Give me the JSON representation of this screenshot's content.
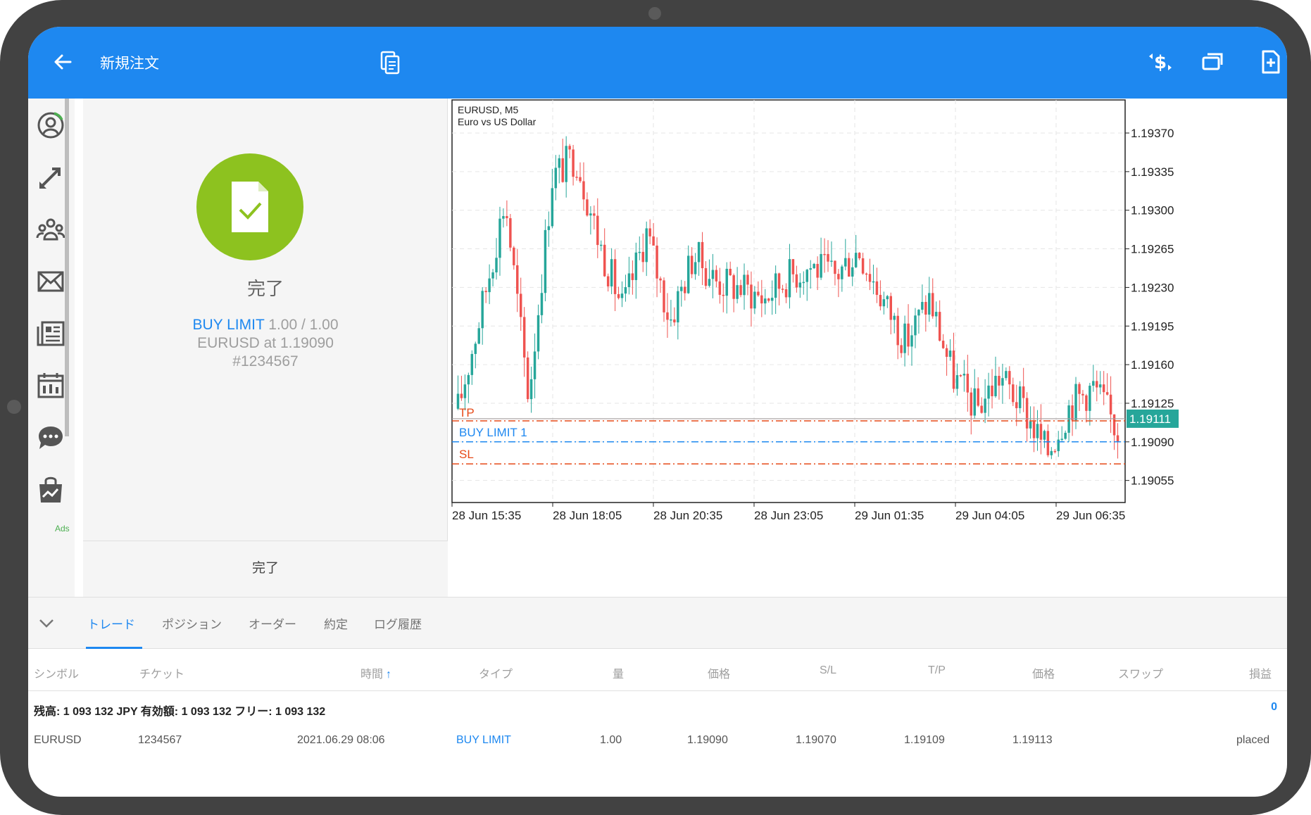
{
  "appbar": {
    "title": "新規注文",
    "icons": [
      "back-arrow-icon",
      "document-icon",
      "currency-exchange-icon",
      "window-icon",
      "new-document-icon"
    ]
  },
  "sidebar": {
    "icons": [
      "account-icon",
      "trade-icon",
      "community-icon",
      "mail-icon",
      "news-icon",
      "calendar-icon",
      "chat-icon",
      "market-bag-icon"
    ],
    "ads_label": "Ads"
  },
  "order_panel": {
    "status_title": "完了",
    "type": "BUY LIMIT",
    "volume": "1.00 / 1.00",
    "symbol_price": "EURUSD at 1.19090",
    "ticket": "#1234567",
    "done_button": "完了"
  },
  "chart": {
    "symbol": "EURUSD, M5",
    "description": "Euro vs US Dollar",
    "price_ticks": [
      "1.19370",
      "1.19335",
      "1.19300",
      "1.19265",
      "1.19230",
      "1.19195",
      "1.19160",
      "1.19125",
      "1.19090",
      "1.19055"
    ],
    "time_ticks": [
      "28 Jun 15:35",
      "28 Jun 18:05",
      "28 Jun 20:35",
      "28 Jun 23:05",
      "29 Jun 01:35",
      "29 Jun 04:05",
      "29 Jun 06:35"
    ],
    "current_price": "1.19111",
    "tp_label": "TP",
    "order_label": "BUY LIMIT 1",
    "sl_label": "SL",
    "tp_price": 1.19109,
    "order_price": 1.1909,
    "sl_price": 1.1907,
    "colors": {
      "bull": "#26a69a",
      "bear": "#ef5350",
      "order": "#1e88f0",
      "stop": "#e64a19"
    }
  },
  "chart_data": {
    "type": "candlestick",
    "title": "EURUSD, M5",
    "subtitle": "Euro vs US Dollar",
    "categories": [
      "28 Jun 15:35",
      "28 Jun 18:05",
      "28 Jun 20:35",
      "28 Jun 23:05",
      "29 Jun 01:35",
      "29 Jun 04:05",
      "29 Jun 06:35"
    ],
    "ylim": [
      1.19035,
      1.194
    ],
    "series": [
      {
        "values": [
          1.1912,
          1.1921,
          1.1931,
          1.1913,
          1.1933,
          1.1935,
          1.1927,
          1.1921,
          1.1928,
          1.192,
          1.1926,
          1.19235,
          1.1923,
          1.1922,
          1.1924,
          1.1925,
          1.1924,
          1.19265,
          1.1922,
          1.1918,
          1.1922,
          1.1915,
          1.1912,
          1.1915,
          1.1912,
          1.1908,
          1.19125,
          1.1914,
          1.191
        ]
      }
    ]
  },
  "tabs": [
    "トレード",
    "ポジション",
    "オーダー",
    "約定",
    "ログ履歴"
  ],
  "table": {
    "headers": [
      "シンボル",
      "チケット",
      "時間",
      "タイプ",
      "量",
      "価格",
      "S/L",
      "T/P",
      "価格",
      "スワップ",
      "損益"
    ],
    "sort_indicator": "↑",
    "balance_line": "残高:  1 093 132 JPY   有効額:  1 093 132   フリー:  1 093 132",
    "balance_profit": "0",
    "rows": [
      [
        "EURUSD",
        "1234567",
        "2021.06.29 08:06",
        "BUY LIMIT",
        "1.00",
        "1.19090",
        "1.19070",
        "1.19109",
        "1.19113",
        "",
        "placed"
      ]
    ]
  }
}
